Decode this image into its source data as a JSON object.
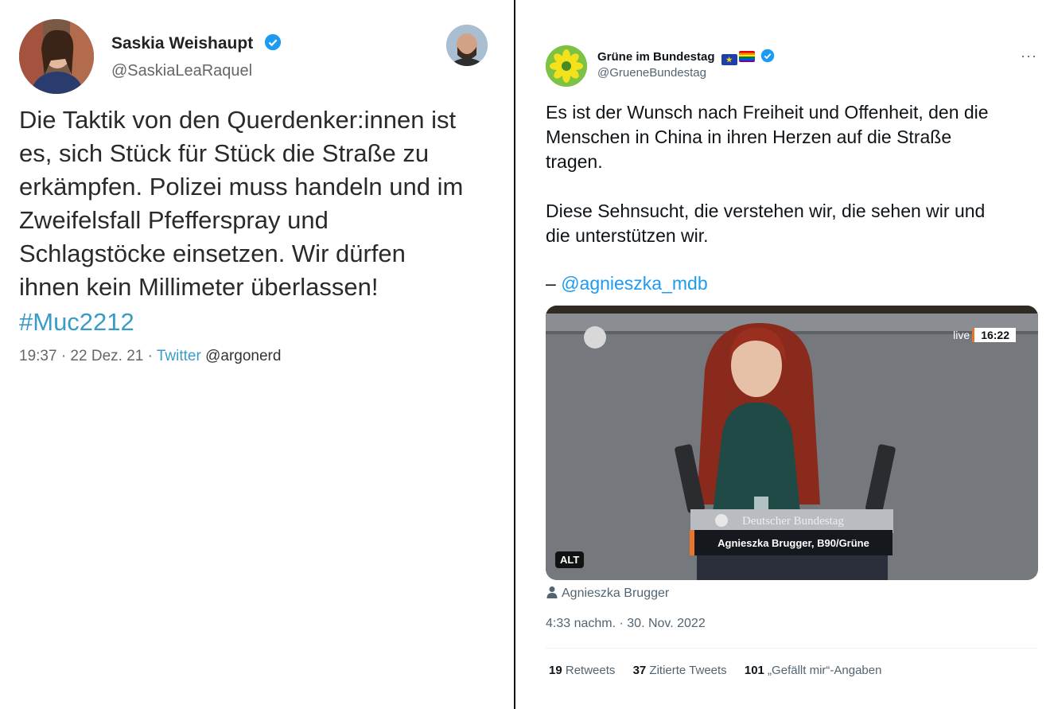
{
  "left_tweet": {
    "author_name": "Saskia Weishaupt",
    "author_handle": "@SaskiaLeaRaquel",
    "text": "Die Taktik von den Querdenker:innen ist\nes, sich Stück für Stück die Straße zu\nerkämpfen. Polizei muss handeln und im\nZweifelsfall Pfefferspray und\nSchlagstöcke einsetzen. Wir dürfen\nihnen kein Millimeter überlassen!",
    "hashtag": "#Muc2212",
    "time": "19:37 · 22 Dez. 21 · ",
    "source": "Twitter",
    "credit": " @argonerd"
  },
  "right_tweet": {
    "author_name": "Grüne im Bundestag",
    "author_handle": "@GrueneBundestag",
    "more": "···",
    "text": "Es ist der Wunsch nach Freiheit und Offenheit, den die\nMenschen in China in ihren Herzen auf die Straße\ntragen.\n\nDiese Sehnsucht, die verstehen wir, die sehen wir und\ndie unterstützen wir.",
    "mention_prefix": "– ",
    "mention": "@agnieszka_mdb",
    "media": {
      "live_label": "live",
      "live_time": "16:22",
      "lectern_label": "Deutscher Bundestag",
      "lower_third": "Agnieszka Brugger, B90/Grüne",
      "alt_badge": "ALT"
    },
    "tagged_person": "Agnieszka Brugger",
    "timestamp": "4:33 nachm. · 30. Nov. 2022",
    "stats": {
      "retweets_count": "19",
      "retweets_label": " Retweets",
      "quotes_count": "37",
      "quotes_label": " Zitierte Tweets",
      "likes_count": "101",
      "likes_label": " „Gefällt mir“-Angaben"
    }
  },
  "colors": {
    "link_blue": "#1d9bf0",
    "verified_blue": "#1d9bf0",
    "accent_orange": "#e8752a"
  }
}
